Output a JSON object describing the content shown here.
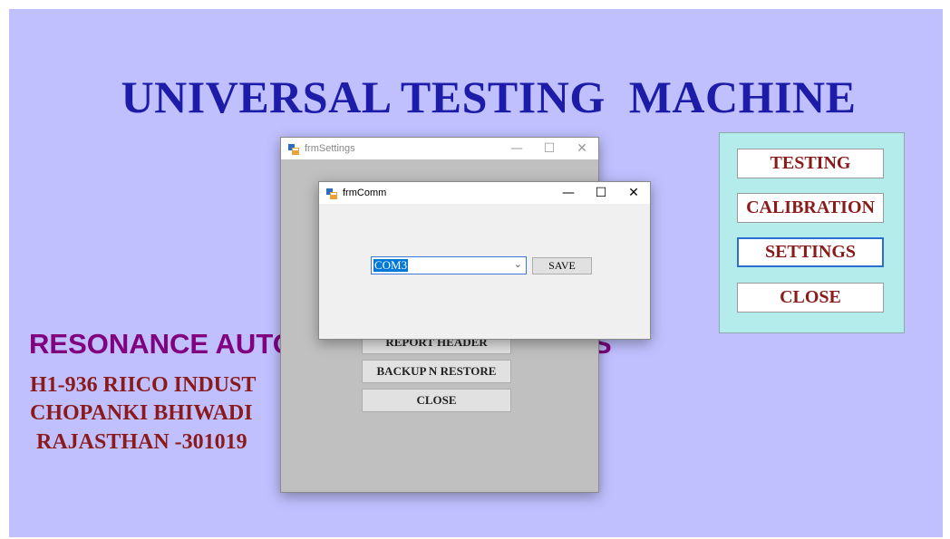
{
  "main": {
    "title": "UNIVERSAL TESTING  MACHINE",
    "company": "RESONANCE AUTO",
    "company_tail": "S",
    "address": [
      "H1-936 RIICO INDUST",
      "CHOPANKI BHIWADI",
      "RAJASTHAN -301019"
    ]
  },
  "menu": {
    "items": [
      {
        "label": "TESTING"
      },
      {
        "label": "CALIBRATION"
      },
      {
        "label": "SETTINGS"
      },
      {
        "label": "CLOSE"
      }
    ]
  },
  "settings_window": {
    "title": "frmSettings",
    "controls": {
      "minimize": "—",
      "maximize": "☐",
      "close": "✕"
    },
    "buttons": [
      {
        "label": "REPORT HEADER"
      },
      {
        "label": "BACKUP N RESTORE"
      },
      {
        "label": "CLOSE"
      }
    ]
  },
  "comm_window": {
    "title": "frmComm",
    "controls": {
      "minimize": "—",
      "maximize": "☐",
      "close": "✕"
    },
    "port": {
      "value": "COM3"
    },
    "save_label": "SAVE"
  },
  "colors": {
    "desktop": "#c0c0ff",
    "title": "#1c1ca8",
    "company": "#800080",
    "address": "#8b1a1a",
    "menu_panel": "#b4ecec"
  },
  "icons": [
    "app-form-icon",
    "minimize-icon",
    "maximize-icon",
    "close-icon",
    "dropdown-arrow-icon"
  ]
}
